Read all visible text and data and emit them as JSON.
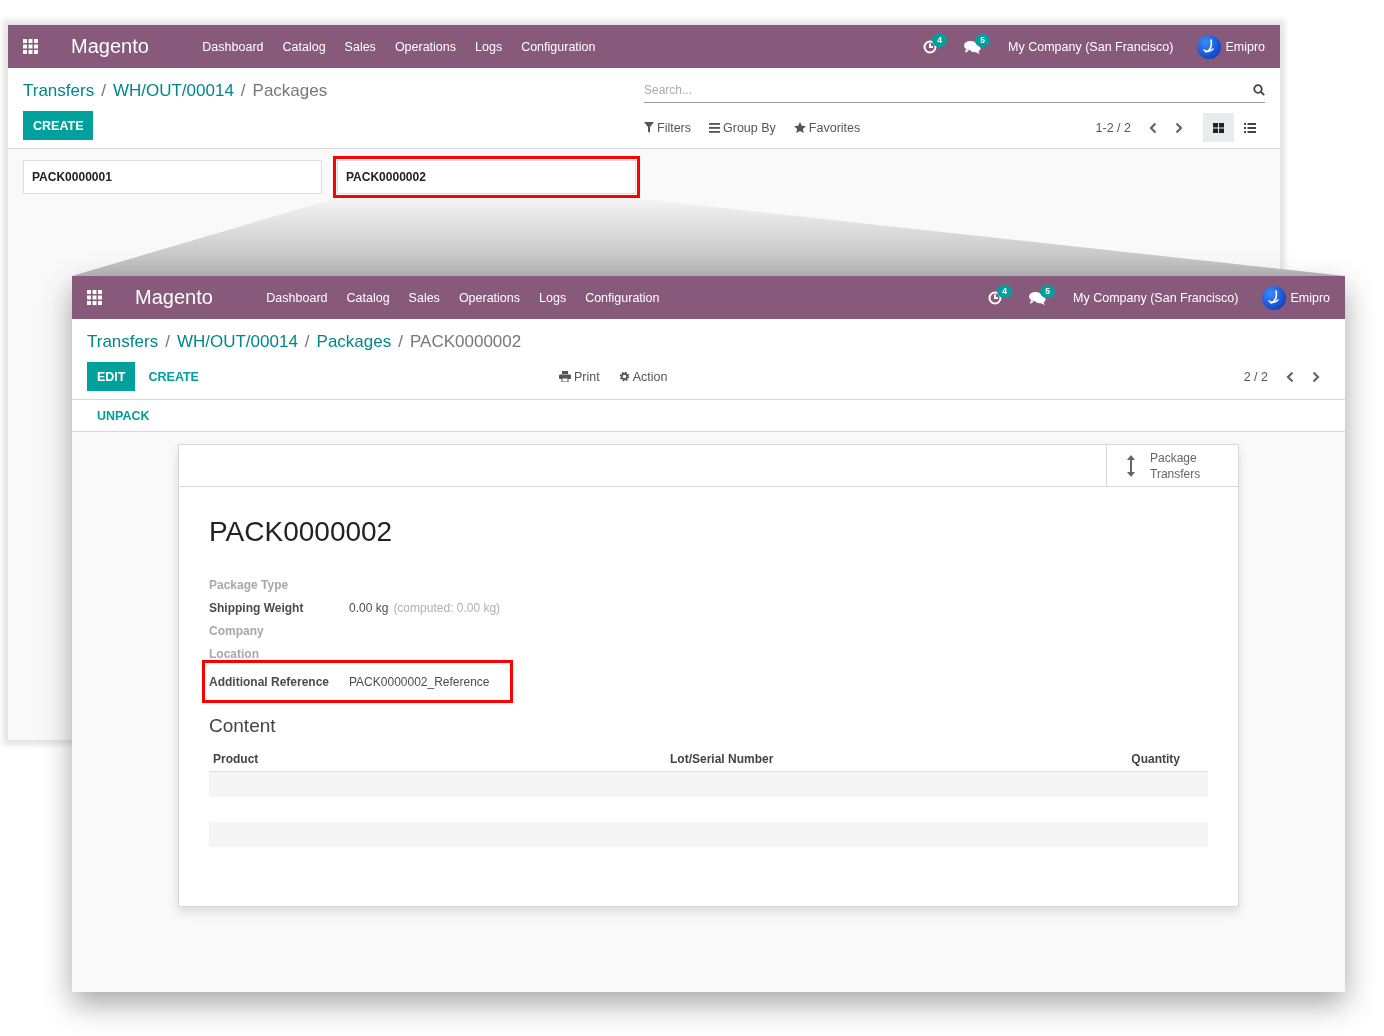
{
  "background_window": {
    "navbar": {
      "app": "Magento",
      "menu": [
        "Dashboard",
        "Catalog",
        "Sales",
        "Operations",
        "Logs",
        "Configuration"
      ],
      "activity_count": "4",
      "message_count": "5",
      "company": "My Company (San Francisco)",
      "user": "Emipro"
    },
    "breadcrumb": [
      {
        "label": "Transfers",
        "current": false
      },
      {
        "label": "WH/OUT/00014",
        "current": false
      },
      {
        "label": "Packages",
        "current": true
      }
    ],
    "separator": "/",
    "create_button": "CREATE",
    "search": {
      "placeholder": "Search..."
    },
    "search_options": [
      {
        "label": "Filters",
        "kind": "filter"
      },
      {
        "label": "Group By",
        "kind": "group"
      },
      {
        "label": "Favorites",
        "kind": "favorite"
      }
    ],
    "pager": "1-2 / 2",
    "views": [
      {
        "kind": "kanban",
        "selected": true
      },
      {
        "kind": "list",
        "selected": false
      }
    ],
    "cards": [
      {
        "name": "PACK0000001",
        "highlighted": false
      },
      {
        "name": "PACK0000002",
        "highlighted": true
      }
    ]
  },
  "foreground_window": {
    "navbar": {
      "app": "Magento",
      "menu": [
        "Dashboard",
        "Catalog",
        "Sales",
        "Operations",
        "Logs",
        "Configuration"
      ],
      "activity_count": "4",
      "message_count": "5",
      "company": "My Company (San Francisco)",
      "user": "Emipro"
    },
    "breadcrumb": [
      {
        "label": "Transfers",
        "current": false
      },
      {
        "label": "WH/OUT/00014",
        "current": false
      },
      {
        "label": "Packages",
        "current": false
      },
      {
        "label": "PACK0000002",
        "current": true
      }
    ],
    "separator": "/",
    "buttons": [
      {
        "label": "EDIT",
        "kind": "primary"
      },
      {
        "label": "CREATE",
        "kind": "link"
      }
    ],
    "actions": [
      {
        "label": "Print",
        "kind": "print"
      },
      {
        "label": "Action",
        "kind": "action"
      }
    ],
    "pager": "2 / 2",
    "header_buttons": [
      "UNPACK"
    ],
    "stat_button": "Package Transfers",
    "title": "PACK0000002",
    "fields": [
      {
        "label": "Package Type",
        "empty": true,
        "highlighted": false
      },
      {
        "label": "Shipping Weight",
        "empty": false,
        "value": "0.00 kg",
        "note": "(computed: 0.00 kg)",
        "highlighted": false
      },
      {
        "label": "Company",
        "empty": true,
        "highlighted": false
      },
      {
        "label": "Location",
        "empty": true,
        "highlighted": false
      },
      {
        "label": "Additional Reference",
        "empty": false,
        "value": "PACK0000002_Reference",
        "highlighted": true
      }
    ],
    "content": {
      "title": "Content",
      "columns": [
        "Product",
        "Lot/Serial Number",
        "Quantity"
      ]
    }
  }
}
